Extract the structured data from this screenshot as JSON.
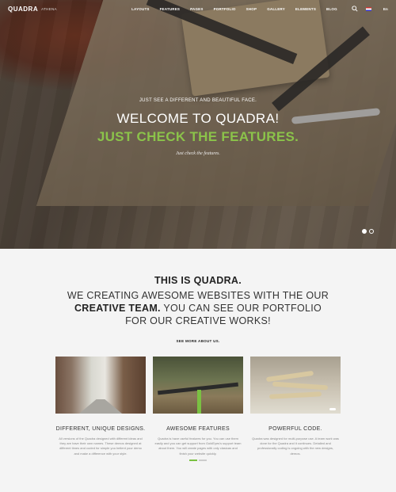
{
  "nav": {
    "logo": "QUADRA",
    "logo_sub": "ATHENA",
    "items": [
      "LAYOUTS",
      "FEATURES",
      "PAGES",
      "PORTFOLIO",
      "SHOP",
      "GALLERY",
      "ELEMENTS",
      "BLOG"
    ],
    "lang": "En",
    "search_icon": "search-icon"
  },
  "hero": {
    "tagline": "JUST SEE A DIFFERENT AND BEAUTIFUL FACE.",
    "title": "WELCOME TO QUADRA!",
    "subtitle": "JUST CHECK THE FEATURES.",
    "italic": "Just check the features."
  },
  "intro": {
    "title": "THIS IS QUADRA.",
    "line1": "WE CREATING AWESOME WEBSITES WITH THE OUR",
    "line2_bold": "CREATIVE TEAM.",
    "line2_rest": " YOU CAN SEE OUR PORTFOLIO",
    "line3": "FOR OUR CREATIVE WORKS!",
    "more": "SEE MORE ABOUT US."
  },
  "features": [
    {
      "title": "DIFFERENT, UNIQUE DESIGNS.",
      "text": "All versions of the Quadra designed with different ideas and they are have their own names. These demos designed at different times and coded for simple you belient your demo and make a difference with your style."
    },
    {
      "title": "AWESOME FEATURES",
      "text": "Quadra is have useful features for you. You can use them easily and you can get support from GoldEyes's support team about them. You will create pages with only clasicas and finish your website quickly."
    },
    {
      "title": "POWERFUL CODE.",
      "text": "Quadra was designed for multi-purpose use. A team work was done for the Quadra and it continues. Detailed and professionally coding is ongoing with the new designs, demos."
    }
  ],
  "colors": {
    "accent": "#7ac142",
    "hero_subtitle": "#8bc34a"
  }
}
